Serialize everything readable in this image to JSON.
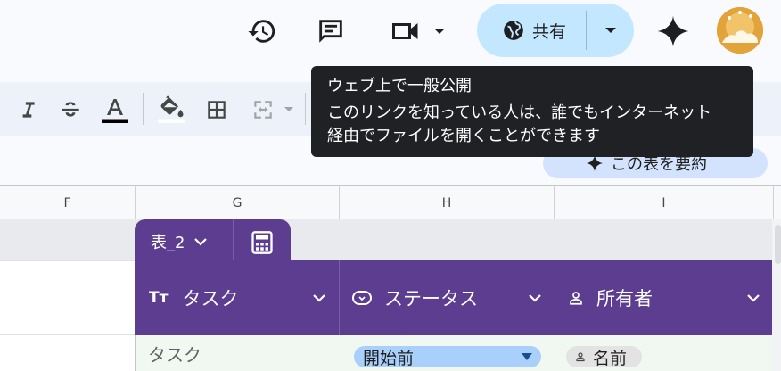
{
  "header": {
    "share_label": "共有"
  },
  "toolbar": {
    "icons": [
      "italic-icon",
      "strikethrough-icon",
      "text-color-icon",
      "fill-color-icon",
      "borders-icon",
      "merge-cells-icon"
    ]
  },
  "summary": {
    "label": "この表を要約"
  },
  "tooltip": {
    "title": "ウェブ上で一般公開",
    "line1": "このリンクを知っている人は、誰でもインターネット",
    "line2": "経由でファイルを開くことができます"
  },
  "columns": [
    "F",
    "G",
    "H",
    "I"
  ],
  "table": {
    "name": "表_2",
    "headers": [
      {
        "label": "タスク",
        "icon": "text-type-icon"
      },
      {
        "label": "ステータス",
        "icon": "dropdown-chip-icon"
      },
      {
        "label": "所有者",
        "icon": "person-icon"
      }
    ],
    "row": {
      "task": "タスク",
      "status": "開始前",
      "owner": "名前"
    }
  },
  "colors": {
    "table_header": "#5c3d8f",
    "share_button": "#c2e7ff",
    "tooltip_bg": "#202124",
    "status_chip": "#a8d0fb"
  }
}
